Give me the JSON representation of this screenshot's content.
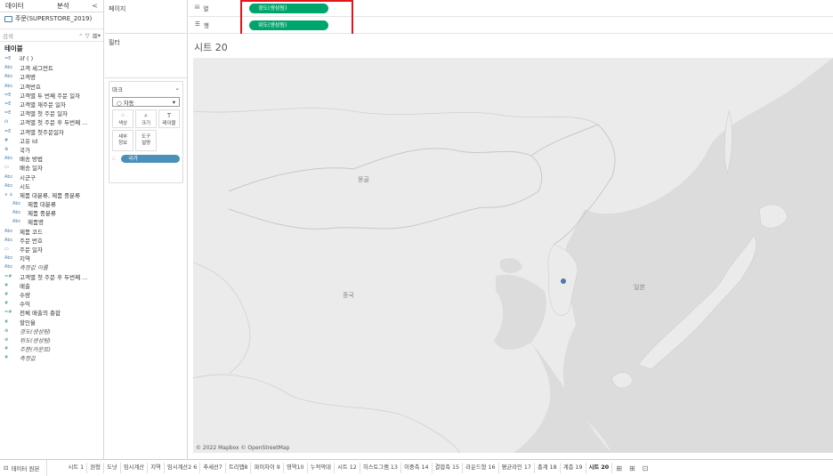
{
  "left_pane": {
    "tab_data": "데이터",
    "tab_analysis": "분석",
    "collapse": "<",
    "datasource": "주문(SUPERSTORE_2019)",
    "search_placeholder": "검색",
    "tables_label": "테이블",
    "fields": [
      {
        "icon": "=E",
        "name": "iif ( )",
        "kind": "dim",
        "italic": false,
        "indent": false
      },
      {
        "icon": "Abc",
        "name": "고객 세그먼트",
        "kind": "dim",
        "italic": false,
        "indent": false
      },
      {
        "icon": "Abc",
        "name": "고객명",
        "kind": "dim",
        "italic": false,
        "indent": false
      },
      {
        "icon": "Abc",
        "name": "고객번호",
        "kind": "dim",
        "italic": false,
        "indent": false
      },
      {
        "icon": "=E",
        "name": "고객별 두 번째 주문 일자",
        "kind": "dim",
        "italic": false,
        "indent": false
      },
      {
        "icon": "=E",
        "name": "고객별 재주문 일자",
        "kind": "dim",
        "italic": false,
        "indent": false
      },
      {
        "icon": "=E",
        "name": "고객별 첫 주문 일자",
        "kind": "dim",
        "italic": false,
        "indent": false
      },
      {
        "icon": "ılı",
        "name": "고객별 첫 주문 후 두번째 ...",
        "kind": "dim",
        "italic": false,
        "indent": false
      },
      {
        "icon": "=E",
        "name": "고객별 첫주문일자",
        "kind": "dim",
        "italic": false,
        "indent": false
      },
      {
        "icon": "#",
        "name": "고유 Id",
        "kind": "dim",
        "italic": false,
        "indent": false
      },
      {
        "icon": "⊕",
        "name": "국가",
        "kind": "dim",
        "italic": false,
        "indent": false
      },
      {
        "icon": "Abc",
        "name": "배송 방법",
        "kind": "dim",
        "italic": false,
        "indent": false
      },
      {
        "icon": "▭",
        "name": "배송 일자",
        "kind": "dim",
        "italic": false,
        "indent": false
      },
      {
        "icon": "Abc",
        "name": "시군구",
        "kind": "dim",
        "italic": false,
        "indent": false
      },
      {
        "icon": "Abc",
        "name": "시도",
        "kind": "dim",
        "italic": false,
        "indent": false
      },
      {
        "icon": "∨ ♙",
        "name": "제품 대분류, 제품 중분류",
        "kind": "dim",
        "italic": false,
        "indent": false
      },
      {
        "icon": "Abc",
        "name": "제품 대분류",
        "kind": "dim",
        "italic": false,
        "indent": true
      },
      {
        "icon": "Abc",
        "name": "제품 중분류",
        "kind": "dim",
        "italic": false,
        "indent": true
      },
      {
        "icon": "Abc",
        "name": "제품명",
        "kind": "dim",
        "italic": false,
        "indent": true
      },
      {
        "icon": "Abc",
        "name": "제품 코드",
        "kind": "dim",
        "italic": false,
        "indent": false
      },
      {
        "icon": "Abc",
        "name": "주문 번호",
        "kind": "dim",
        "italic": false,
        "indent": false
      },
      {
        "icon": "▭",
        "name": "주문 일자",
        "kind": "dim",
        "italic": false,
        "indent": false
      },
      {
        "icon": "Abc",
        "name": "지역",
        "kind": "dim",
        "italic": false,
        "indent": false
      },
      {
        "icon": "Abc",
        "name": "측정값 이름",
        "kind": "dim",
        "italic": true,
        "indent": false
      },
      {
        "icon": "=#",
        "name": "고객별 첫 주문 후 두번째 ...",
        "kind": "mea",
        "italic": false,
        "indent": false
      },
      {
        "icon": "#",
        "name": "매출",
        "kind": "mea",
        "italic": false,
        "indent": false
      },
      {
        "icon": "#",
        "name": "수량",
        "kind": "mea",
        "italic": false,
        "indent": false
      },
      {
        "icon": "#",
        "name": "수익",
        "kind": "mea",
        "italic": false,
        "indent": false
      },
      {
        "icon": "=#",
        "name": "전체 매출의 총합",
        "kind": "mea",
        "italic": false,
        "indent": false
      },
      {
        "icon": "#",
        "name": "할인율",
        "kind": "mea",
        "italic": false,
        "indent": false
      },
      {
        "icon": "⊕",
        "name": "경도(생성됨)",
        "kind": "mea",
        "italic": true,
        "indent": false
      },
      {
        "icon": "⊕",
        "name": "위도(생성됨)",
        "kind": "mea",
        "italic": true,
        "indent": false
      },
      {
        "icon": "#",
        "name": "주문(카운트)",
        "kind": "mea",
        "italic": true,
        "indent": false
      },
      {
        "icon": "#",
        "name": "측정값",
        "kind": "mea",
        "italic": true,
        "indent": false
      }
    ]
  },
  "shelves": {
    "pages_label": "페이지",
    "filters_label": "필터",
    "marks_label": "마크",
    "marks_type": "자동",
    "mark_color": "색상",
    "mark_size": "크기",
    "mark_label": "레이블",
    "mark_detail": "세부\n정보",
    "mark_tooltip": "도구\n설명",
    "detail_pill": "국가"
  },
  "shelf_bar": {
    "columns_label": "열",
    "columns_pill": "경도(생성됨)",
    "rows_label": "행",
    "rows_pill": "위도(생성됨)"
  },
  "viz": {
    "sheet_title": "시트 20",
    "label_mongolia": "몽골",
    "label_china": "중국",
    "label_japan": "일본",
    "attribution": "© 2022 Mapbox © OpenStreetMap",
    "point_color": "#4e79a7"
  },
  "bottom_tabs": {
    "datasource_tab": "데이터 원본",
    "sheets": [
      "시트 1",
      "원형",
      "도넛",
      "임시계산",
      "지역",
      "임시계산2 6",
      "추세선7",
      "트리맵8",
      "파이차이 9",
      "영역10",
      "누적막대",
      "시트 12",
      "히스토그램 13",
      "이중축 14",
      "결합축 15",
      "라운드형 16",
      "평균라인 17",
      "총계 18",
      "계층 19",
      "시트 20"
    ],
    "active_sheet": "시트 20"
  },
  "colors": {
    "pill_green": "#00a56e",
    "pill_blue": "#4a90b8",
    "highlight": "#e4151b"
  }
}
